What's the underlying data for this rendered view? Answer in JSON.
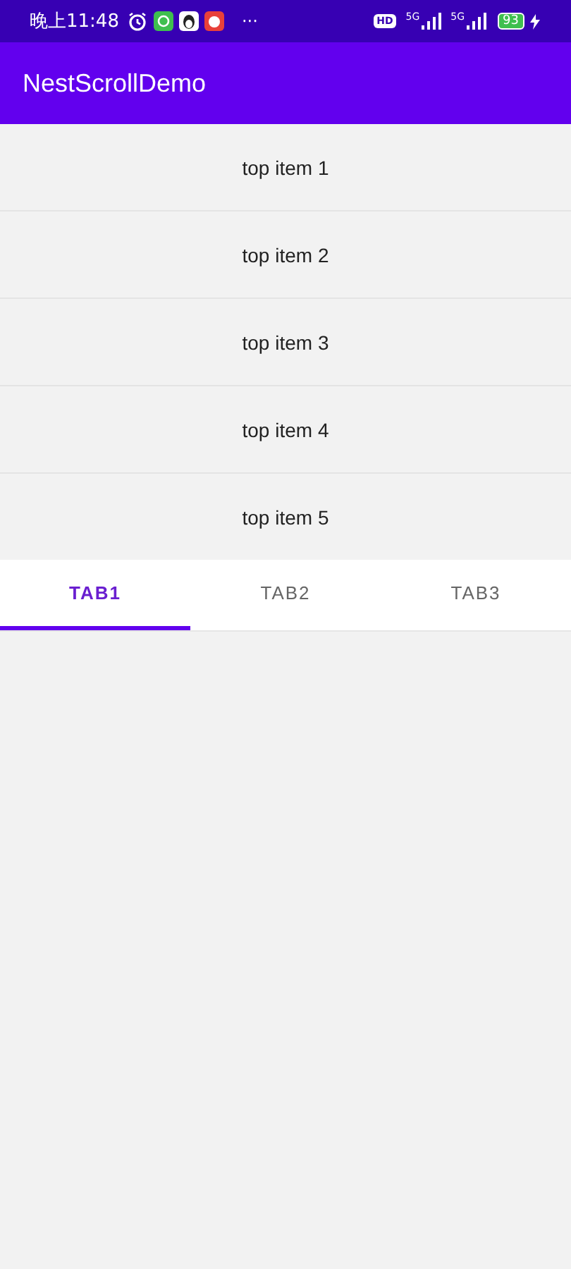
{
  "status_bar": {
    "time": "晚上11:48",
    "more": "···",
    "hd": "HD",
    "network_1": "5G",
    "network_2": "5G",
    "battery": "93"
  },
  "app_bar": {
    "title": "NestScrollDemo"
  },
  "top_items": [
    "top item 1",
    "top item 2",
    "top item 3",
    "top item 4",
    "top item 5"
  ],
  "tabs": [
    {
      "label": "TAB1",
      "selected": true
    },
    {
      "label": "TAB2",
      "selected": false
    },
    {
      "label": "TAB3",
      "selected": false
    }
  ]
}
